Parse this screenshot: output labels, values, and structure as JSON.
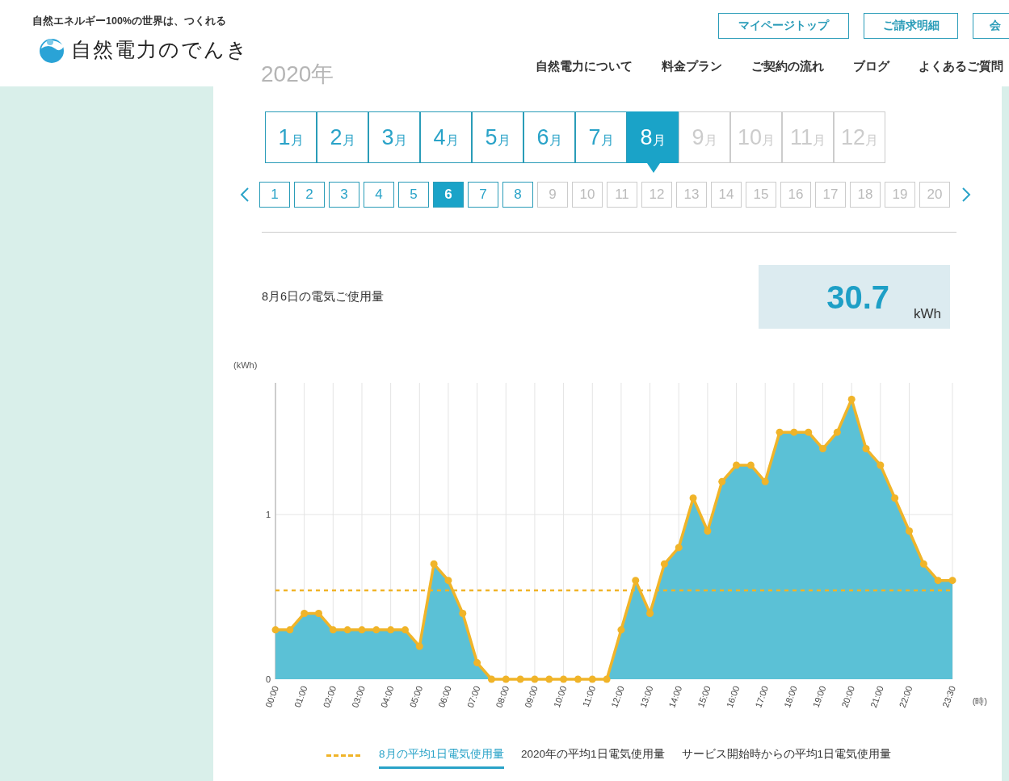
{
  "header": {
    "tagline": "自然エネルギー100%の世界は、つくれる",
    "logo_text": "自然電力のでんき",
    "account_links": [
      "マイページトップ",
      "ご請求明細",
      "会"
    ],
    "nav": [
      "自然電力について",
      "料金プラン",
      "ご契約の流れ",
      "ブログ",
      "よくあるご質問"
    ]
  },
  "year_heading": "2020年",
  "months": [
    {
      "number": "1",
      "unit": "月",
      "selected": false,
      "disabled": false
    },
    {
      "number": "2",
      "unit": "月",
      "selected": false,
      "disabled": false
    },
    {
      "number": "3",
      "unit": "月",
      "selected": false,
      "disabled": false
    },
    {
      "number": "4",
      "unit": "月",
      "selected": false,
      "disabled": false
    },
    {
      "number": "5",
      "unit": "月",
      "selected": false,
      "disabled": false
    },
    {
      "number": "6",
      "unit": "月",
      "selected": false,
      "disabled": false
    },
    {
      "number": "7",
      "unit": "月",
      "selected": false,
      "disabled": false
    },
    {
      "number": "8",
      "unit": "月",
      "selected": true,
      "disabled": false
    },
    {
      "number": "9",
      "unit": "月",
      "selected": false,
      "disabled": true
    },
    {
      "number": "10",
      "unit": "月",
      "selected": false,
      "disabled": true
    },
    {
      "number": "11",
      "unit": "月",
      "selected": false,
      "disabled": true
    },
    {
      "number": "12",
      "unit": "月",
      "selected": false,
      "disabled": true
    }
  ],
  "days": [
    {
      "label": "1",
      "selected": false,
      "disabled": false
    },
    {
      "label": "2",
      "selected": false,
      "disabled": false
    },
    {
      "label": "3",
      "selected": false,
      "disabled": false
    },
    {
      "label": "4",
      "selected": false,
      "disabled": false
    },
    {
      "label": "5",
      "selected": false,
      "disabled": false
    },
    {
      "label": "6",
      "selected": true,
      "disabled": false
    },
    {
      "label": "7",
      "selected": false,
      "disabled": false
    },
    {
      "label": "8",
      "selected": false,
      "disabled": false
    },
    {
      "label": "9",
      "selected": false,
      "disabled": true
    },
    {
      "label": "10",
      "selected": false,
      "disabled": true
    },
    {
      "label": "11",
      "selected": false,
      "disabled": true
    },
    {
      "label": "12",
      "selected": false,
      "disabled": true
    },
    {
      "label": "13",
      "selected": false,
      "disabled": true
    },
    {
      "label": "14",
      "selected": false,
      "disabled": true
    },
    {
      "label": "15",
      "selected": false,
      "disabled": true
    },
    {
      "label": "16",
      "selected": false,
      "disabled": true
    },
    {
      "label": "17",
      "selected": false,
      "disabled": true
    },
    {
      "label": "18",
      "selected": false,
      "disabled": true
    },
    {
      "label": "19",
      "selected": false,
      "disabled": true
    },
    {
      "label": "20",
      "selected": false,
      "disabled": true
    }
  ],
  "summary": {
    "label": "8月6日の電気ご使用量",
    "value": "30.7",
    "unit": "kWh"
  },
  "chart_data": {
    "type": "area",
    "xlabel": "(時)",
    "ylabel": "(kWh)",
    "x": [
      0,
      0.5,
      1,
      1.5,
      2,
      2.5,
      3,
      3.5,
      4,
      4.5,
      5,
      5.5,
      6,
      6.5,
      7,
      7.5,
      8,
      8.5,
      9,
      9.5,
      10,
      10.5,
      11,
      11.5,
      12,
      12.5,
      13,
      13.5,
      14,
      14.5,
      15,
      15.5,
      16,
      16.5,
      17,
      17.5,
      18,
      18.5,
      19,
      19.5,
      20,
      20.5,
      21,
      21.5,
      22,
      22.5,
      23,
      23.5
    ],
    "series": [
      {
        "color": "#f0b429",
        "values": [
          0.3,
          0.3,
          0.4,
          0.4,
          0.3,
          0.3,
          0.3,
          0.3,
          0.3,
          0.3,
          0.2,
          0.7,
          0.6,
          0.4,
          0.1,
          0,
          0,
          0,
          0,
          0,
          0,
          0,
          0,
          0,
          0.3,
          0.6,
          0.4,
          0.7,
          0.8,
          1.1,
          0.9,
          1.2,
          1.3,
          1.3,
          1.2,
          1.5,
          1.5,
          1.5,
          1.4,
          1.5,
          1.7,
          1.4,
          1.3,
          1.1,
          0.9,
          0.7,
          0.6,
          0.6
        ]
      },
      {
        "type": "line",
        "line_style": "dashed",
        "color": "#f0b429",
        "values": [
          0.54,
          0.54,
          0.54,
          0.54,
          0.54,
          0.54,
          0.54,
          0.54,
          0.54,
          0.54,
          0.54,
          0.54,
          0.54,
          0.54,
          0.54,
          0.54,
          0.54,
          0.54,
          0.54,
          0.54,
          0.54,
          0.54,
          0.54,
          0.54,
          0.54,
          0.54,
          0.54,
          0.54,
          0.54,
          0.54,
          0.54,
          0.54,
          0.54,
          0.54,
          0.54,
          0.54,
          0.54,
          0.54,
          0.54,
          0.54,
          0.54,
          0.54,
          0.54,
          0.54,
          0.54,
          0.54,
          0.54,
          0.54
        ]
      }
    ],
    "xlim": [
      0,
      23.5
    ],
    "ylim": [
      0,
      1.8
    ],
    "yticks": [
      0,
      1
    ],
    "xticks": [
      {
        "value": 0,
        "label": "00:00"
      },
      {
        "value": 1,
        "label": "01:00"
      },
      {
        "value": 2,
        "label": "02:00"
      },
      {
        "value": 3,
        "label": "03:00"
      },
      {
        "value": 4,
        "label": "04:00"
      },
      {
        "value": 5,
        "label": "05:00"
      },
      {
        "value": 6,
        "label": "06:00"
      },
      {
        "value": 7,
        "label": "07:00"
      },
      {
        "value": 8,
        "label": "08:00"
      },
      {
        "value": 9,
        "label": "09:00"
      },
      {
        "value": 10,
        "label": "10:00"
      },
      {
        "value": 11,
        "label": "11:00"
      },
      {
        "value": 12,
        "label": "12:00"
      },
      {
        "value": 13,
        "label": "13:00"
      },
      {
        "value": 14,
        "label": "14:00"
      },
      {
        "value": 15,
        "label": "15:00"
      },
      {
        "value": 16,
        "label": "16:00"
      },
      {
        "value": 17,
        "label": "17:00"
      },
      {
        "value": 18,
        "label": "18:00"
      },
      {
        "value": 19,
        "label": "19:00"
      },
      {
        "value": 20,
        "label": "20:00"
      },
      {
        "value": 21,
        "label": "21:00"
      },
      {
        "value": 22,
        "label": "22:00"
      },
      {
        "value": 23.5,
        "label": "23:30"
      }
    ],
    "grid": true
  },
  "legend": [
    {
      "label": "8月の平均1日電気使用量",
      "selected": true
    },
    {
      "label": "2020年の平均1日電気使用量",
      "selected": false
    },
    {
      "label": "サービス開始時からの平均1日電気使用量",
      "selected": false
    }
  ]
}
